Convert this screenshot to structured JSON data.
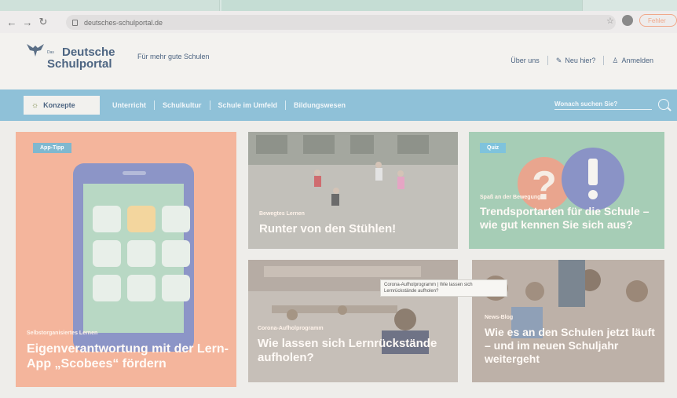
{
  "browser": {
    "url": "deutsches-schulportal.de",
    "error_label": "Fehler"
  },
  "header": {
    "logo_small": "Das",
    "logo_line1": "Deutsche",
    "logo_line2": "Schulportal",
    "tagline": "Für mehr gute Schulen",
    "links": {
      "about": "Über uns",
      "new_here": "Neu hier?",
      "login": "Anmelden"
    }
  },
  "mainnav": {
    "active": "Konzepte",
    "items": [
      "Unterricht",
      "Schulkultur",
      "Schule im Umfeld",
      "Bildungswesen"
    ],
    "search_placeholder": "Wonach suchen Sie?"
  },
  "cards": [
    {
      "badge": "App-Tipp",
      "kicker": "Selbstorganisiertes Lernen",
      "headline": "Eigenverantwortung mit der Lern-App „Scobees“ fördern"
    },
    {
      "kicker": "Bewegtes Lernen",
      "headline": "Runter von den Stühlen!"
    },
    {
      "badge": "Quiz",
      "kicker": "Spaß an der Bewegung",
      "headline": "Trendsportarten für die Schule – wie gut kennen Sie sich aus?"
    },
    {
      "kicker": "Corona-Aufholprogramm",
      "headline": "Wie lassen sich Lernrückstände aufholen?"
    },
    {
      "kicker": "News-Blog",
      "headline": "Wie es an den Schulen jetzt läuft – und im neuen Schuljahr weitergeht"
    }
  ],
  "tooltip": "Corona-Aufholprogramm | Wie lassen sich Lernrückstände aufholen?",
  "colors": {
    "nav_bar": "#8fc1d8",
    "badge_app": "#7fb8cf",
    "badge_quiz": "#7fc3dc",
    "brand_text": "#4d6582"
  }
}
